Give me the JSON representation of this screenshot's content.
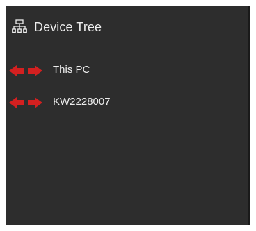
{
  "panel": {
    "title": "Device Tree",
    "title_icon": "device-tree-icon",
    "background_color": "#2d2d2d",
    "text_color": "#ededed",
    "status_color": "#d32020"
  },
  "tree": {
    "items": [
      {
        "label": "This PC",
        "icon": "disconnected-arrows-icon"
      },
      {
        "label": "KW2228007",
        "icon": "disconnected-arrows-icon"
      }
    ]
  }
}
